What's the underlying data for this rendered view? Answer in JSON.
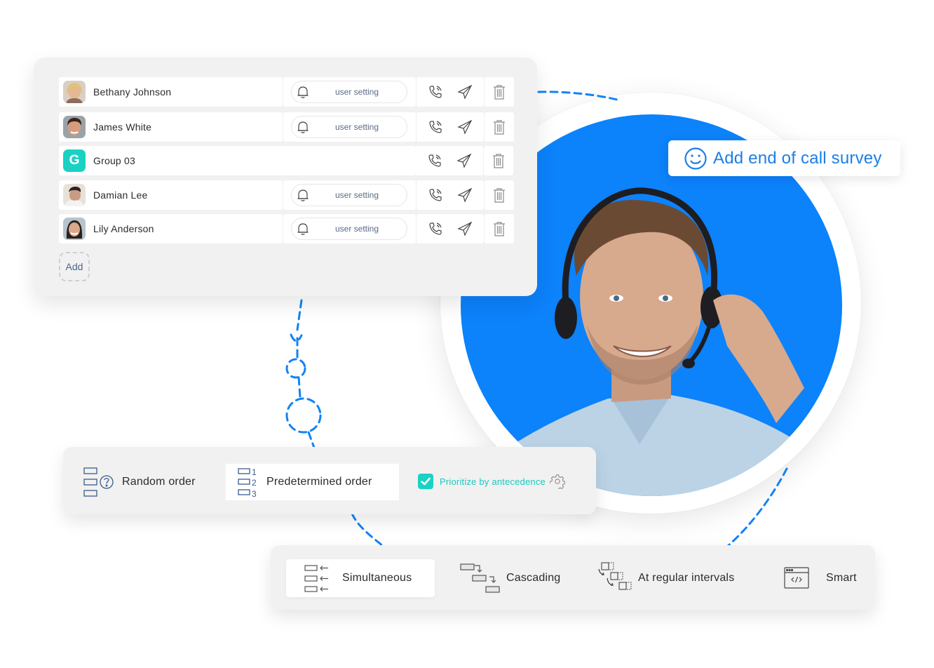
{
  "users_panel": {
    "rows": [
      {
        "name": "Bethany Johnson",
        "avatar": "photo",
        "setting_label": "user setting",
        "has_setting": true
      },
      {
        "name": "James White",
        "avatar": "photo",
        "setting_label": "user setting",
        "has_setting": true
      },
      {
        "name": "Group 03",
        "avatar": "letter",
        "avatar_letter": "G",
        "has_setting": false
      },
      {
        "name": "Damian Lee",
        "avatar": "photo",
        "setting_label": "user setting",
        "has_setting": true
      },
      {
        "name": "Lily Anderson",
        "avatar": "photo",
        "setting_label": "user setting",
        "has_setting": true
      }
    ],
    "row_icons": [
      "bell-icon",
      "phone-call-icon",
      "send-icon",
      "trash-icon"
    ],
    "add_label": "Add"
  },
  "survey_badge": {
    "icon": "smiley-icon",
    "label": "Add end of call survey"
  },
  "order_panel": {
    "options": [
      {
        "label": "Random order",
        "icon": "random-order-icon",
        "selected": false
      },
      {
        "label": "Predetermined order",
        "icon": "numbered-order-icon",
        "selected": true,
        "numbers": [
          "1",
          "2",
          "3"
        ]
      }
    ],
    "prioritize": {
      "label": "Prioritize by antecedence",
      "checked": true,
      "icon": "gear-icon"
    }
  },
  "strategy_panel": {
    "options": [
      {
        "label": "Simultaneous",
        "icon": "simultaneous-icon",
        "selected": true
      },
      {
        "label": "Cascading",
        "icon": "cascading-icon",
        "selected": false
      },
      {
        "label": "At regular intervals",
        "icon": "intervals-icon",
        "selected": false
      },
      {
        "label": "Smart",
        "icon": "code-window-icon",
        "selected": false
      }
    ]
  },
  "colors": {
    "brand_blue": "#0c82fb",
    "accent_teal": "#19d2c4",
    "panel_bg": "#f1f1f1",
    "survey_text": "#1a7fe8",
    "setting_text": "#5a6b86"
  }
}
